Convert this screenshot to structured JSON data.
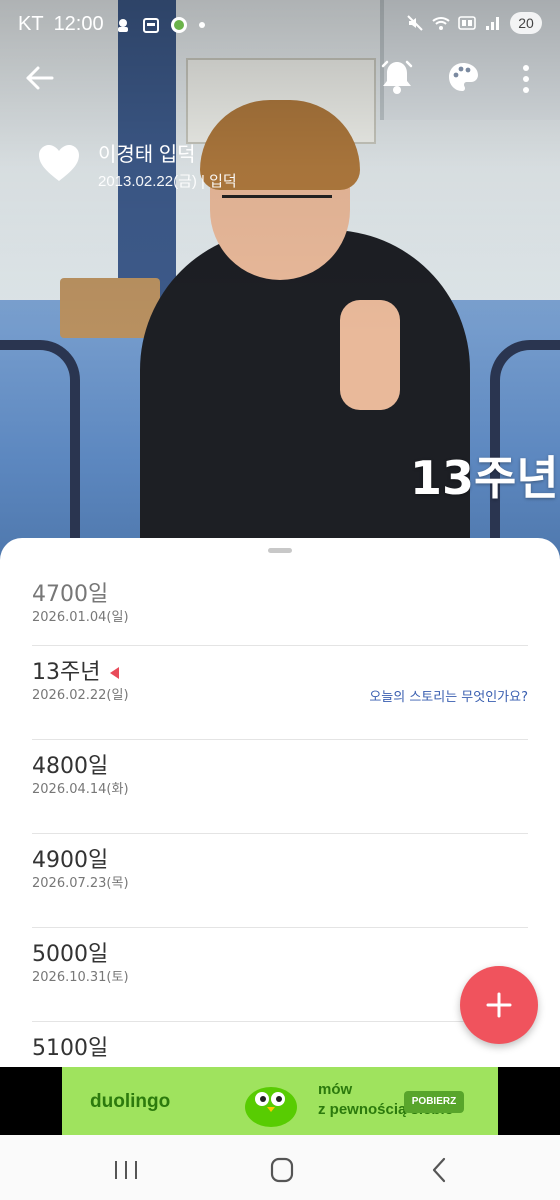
{
  "status_bar": {
    "carrier": "KT",
    "time": "12:00",
    "battery": "20"
  },
  "event": {
    "title": "이경태 입덕",
    "subtitle": "2013.02.22(금) | 입덕",
    "anniversary_badge": "13주년"
  },
  "milestones": [
    {
      "label": "4700일",
      "date": "2026.01.04(일)"
    },
    {
      "label": "13주년",
      "date": "2026.02.22(일)",
      "story_prompt": "오늘의 스토리는 무엇인가요?"
    },
    {
      "label": "4800일",
      "date": "2026.04.14(화)"
    },
    {
      "label": "4900일",
      "date": "2026.07.23(목)"
    },
    {
      "label": "5000일",
      "date": "2026.10.31(토)"
    },
    {
      "label": "5100일",
      "date": ""
    }
  ],
  "ad": {
    "brand": "duolingo",
    "line1": "mów",
    "line2": "z pewnością siebie",
    "cta": "POBIERZ"
  },
  "colors": {
    "accent": "#f0535d",
    "link": "#3a5fb0"
  },
  "icons": {
    "back": "arrow-left-icon",
    "alarm": "bell-icon",
    "theme": "palette-icon",
    "menu": "more-vertical-icon",
    "favorite": "heart-icon",
    "add": "plus-icon"
  }
}
